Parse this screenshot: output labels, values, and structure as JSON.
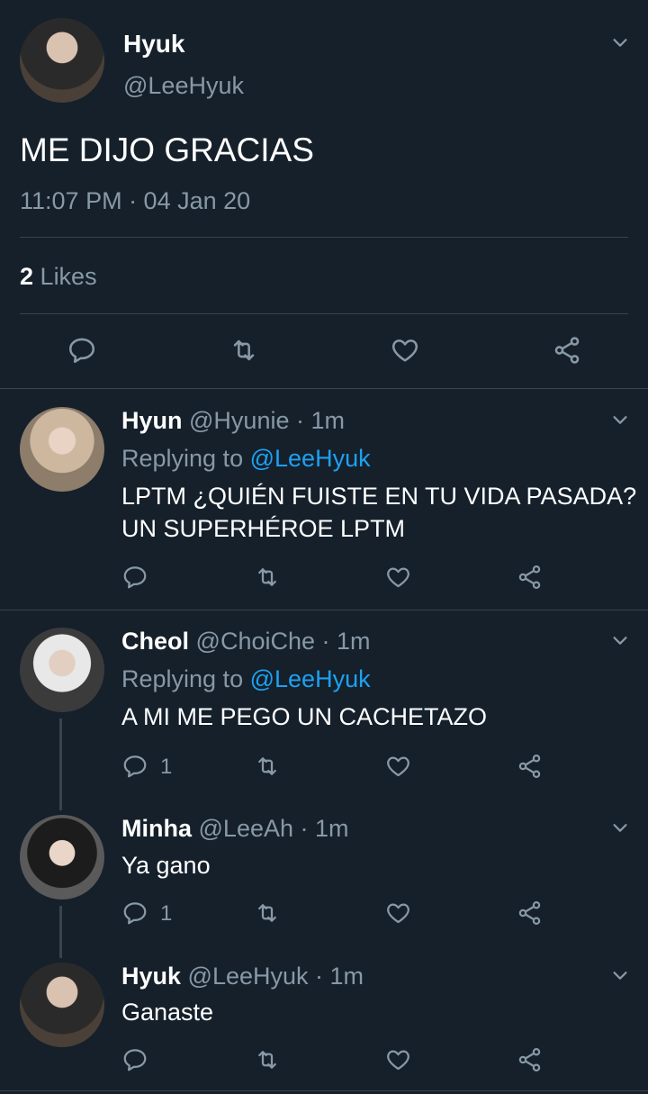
{
  "main_tweet": {
    "name": "Hyuk",
    "handle": "@LeeHyuk",
    "text": "ME DIJO GRACIAS",
    "timestamp": "11:07 PM · 04 Jan 20",
    "likes_count": "2",
    "likes_label": "Likes"
  },
  "replies": [
    {
      "name": "Hyun",
      "handle": "@Hyunie",
      "time": "· 1m",
      "replying_label": "Replying to",
      "replying_to": "@LeeHyuk",
      "text_line1": "LPTM ¿QUIÉN FUISTE EN TU VIDA PASADA?",
      "text_line2": "UN SUPERHÉROE LPTM",
      "reply_count": ""
    },
    {
      "name": "Cheol",
      "handle": "@ChoiChe",
      "time": "· 1m",
      "replying_label": "Replying to",
      "replying_to": "@LeeHyuk",
      "text_line1": "A MI ME PEGO UN CACHETAZO",
      "reply_count": "1"
    },
    {
      "name": "Minha",
      "handle": "@LeeAh",
      "time": "· 1m",
      "text_line1": "Ya gano",
      "reply_count": "1"
    },
    {
      "name": "Hyuk",
      "handle": "@LeeHyuk",
      "time": "· 1m",
      "text_line1": "Ganaste",
      "reply_count": ""
    }
  ],
  "colors": {
    "background": "#15202b",
    "muted": "#8899a6",
    "link": "#1da1f2",
    "divider": "#38444d"
  }
}
